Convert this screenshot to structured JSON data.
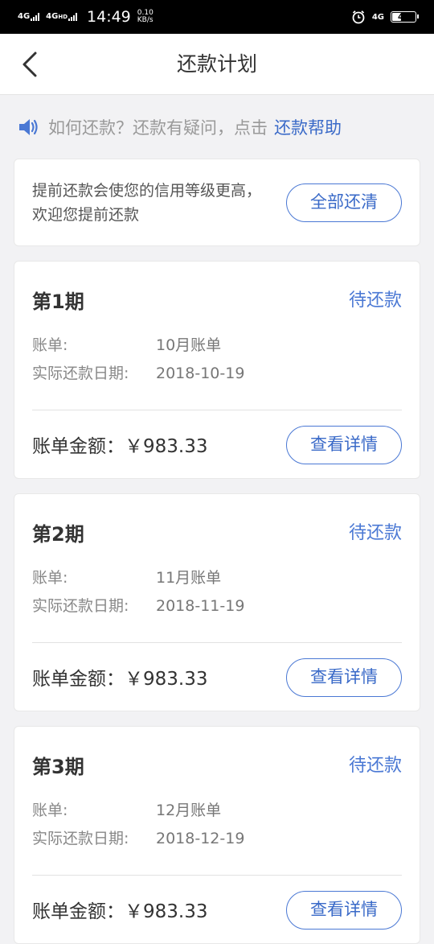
{
  "status_bar": {
    "net1": "4G",
    "net2": "4G",
    "net2_sup": "HD",
    "time": "14:49",
    "speed_value": "0.10",
    "speed_unit": "KB/s",
    "net3": "4G",
    "battery": "44",
    "battery_level": 0.44
  },
  "nav": {
    "title": "还款计划"
  },
  "notice": {
    "text": "如何还款？还款有疑问，点击",
    "link": "还款帮助",
    "accent_color": "#4a78d4"
  },
  "tip": {
    "text": "提前还款会使您的信用等级更高，欢迎您提前还款",
    "button": "全部还清"
  },
  "periods": [
    {
      "title": "第1期",
      "status": "待还款",
      "bill_label": "账单:",
      "bill_value": "10月账单",
      "date_label": "实际还款日期:",
      "date_value": "2018-10-19",
      "amount": "账单金额：￥983.33",
      "button": "查看详情"
    },
    {
      "title": "第2期",
      "status": "待还款",
      "bill_label": "账单:",
      "bill_value": "11月账单",
      "date_label": "实际还款日期:",
      "date_value": "2018-11-19",
      "amount": "账单金额：￥983.33",
      "button": "查看详情"
    },
    {
      "title": "第3期",
      "status": "待还款",
      "bill_label": "账单:",
      "bill_value": "12月账单",
      "date_label": "实际还款日期:",
      "date_value": "2018-12-19",
      "amount": "账单金额：￥983.33",
      "button": "查看详情"
    }
  ]
}
